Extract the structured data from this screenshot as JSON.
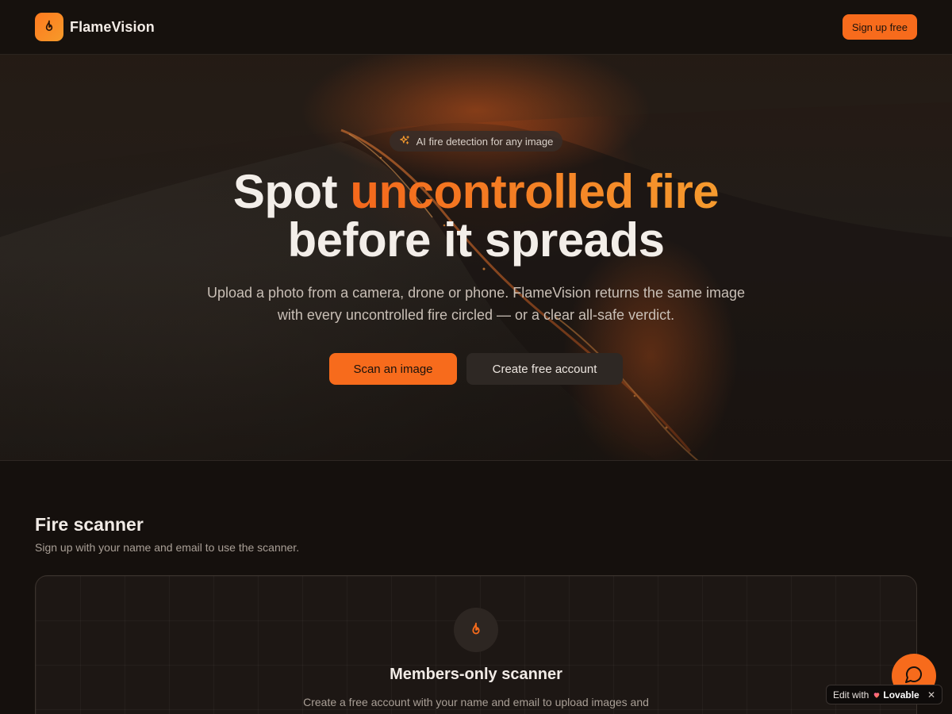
{
  "brand": {
    "name": "FlameVision",
    "logo_icon": "flame-icon"
  },
  "header": {
    "signup_label": "Sign up free"
  },
  "hero": {
    "badge_text": "AI fire detection for any image",
    "badge_icon": "sparkles-icon",
    "headline_part1": "Spot ",
    "headline_accent": "uncontrolled fire",
    "headline_line2": "before it spreads",
    "subheadline": "Upload a photo from a camera, drone or phone. FlameVision returns the same image with every uncontrolled fire circled — or a clear all-safe verdict.",
    "primary_cta": "Scan an image",
    "secondary_cta": "Create free account"
  },
  "scanner": {
    "title": "Fire scanner",
    "subtitle": "Sign up with your name and email to use the scanner.",
    "card_icon": "flame-icon",
    "card_title": "Members-only scanner",
    "card_description": "Create a free account with your name and email to upload images and receive annotated fire detection results."
  },
  "floating": {
    "chat_icon": "chat-bubble-icon",
    "edit_with": "Edit with",
    "lovable_label": "Lovable",
    "close_label": "✕"
  },
  "colors": {
    "accent": "#f76b1c",
    "accent_gradient_end": "#f59a2e",
    "background": "#15100d",
    "card": "#1d1714"
  }
}
